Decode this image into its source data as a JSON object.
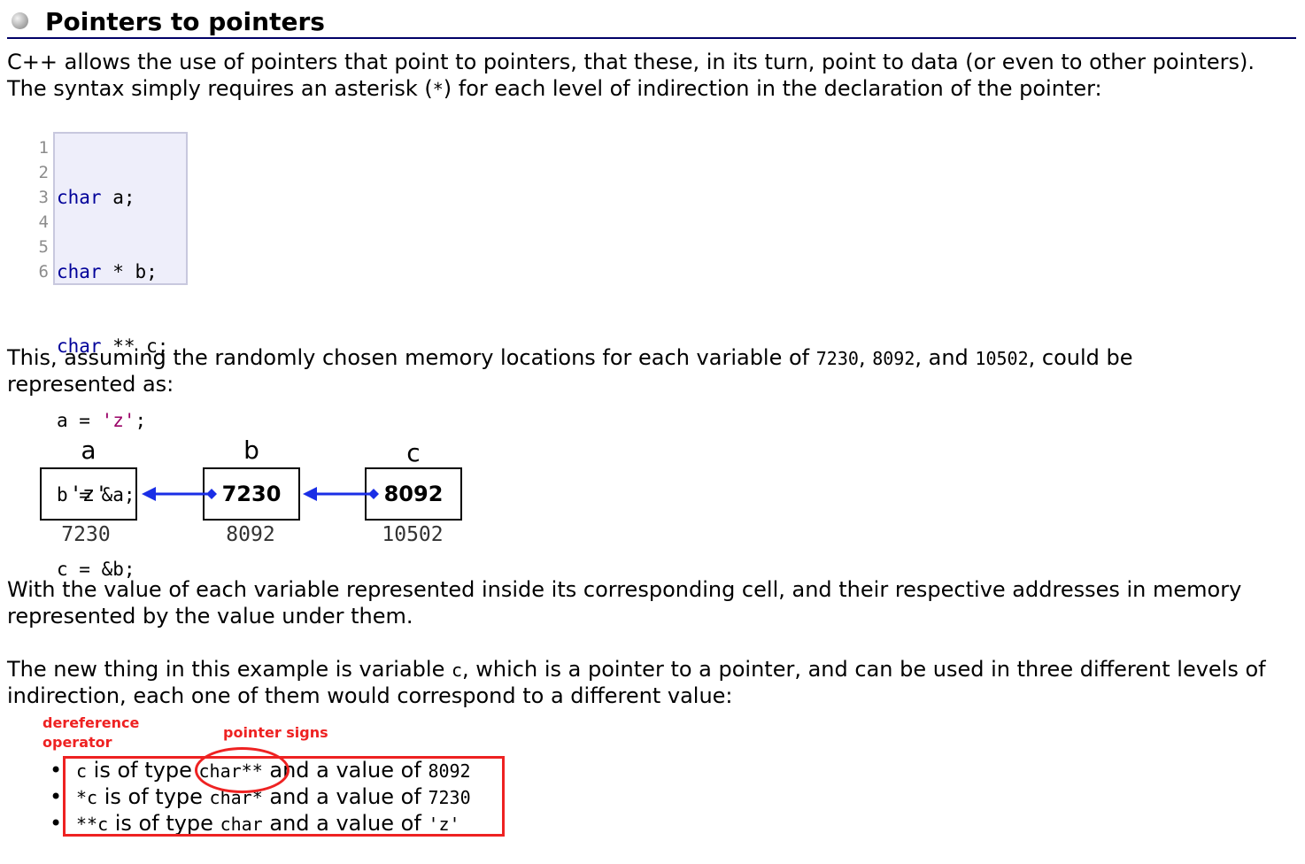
{
  "heading": {
    "icon": "bullet-icon",
    "title": "Pointers to pointers"
  },
  "intro": {
    "line1": "C++ allows the use of pointers that point to pointers, that these, in its turn, point to data (or even to other pointers).",
    "line2_pre": "The syntax simply requires an asterisk (",
    "line2_code": "*",
    "line2_post": ") for each level of indirection in the declaration of the pointer:"
  },
  "code": {
    "line_numbers": [
      "1",
      "2",
      "3",
      "4",
      "5",
      "6"
    ],
    "lines": [
      {
        "kw": "char",
        "rest": " a;"
      },
      {
        "kw": "char",
        "rest": " * b;"
      },
      {
        "kw": "char",
        "rest": " ** c;"
      },
      {
        "pre": "a = ",
        "str": "'z'",
        "post": ";"
      },
      {
        "pre": "b = &a;"
      },
      {
        "pre": "c = &b;"
      }
    ]
  },
  "assume": {
    "line1_pre": "This, assuming the randomly chosen memory locations for each variable of ",
    "v1": "7230",
    "sep1": ", ",
    "v2": "8092",
    "sep2": ", and ",
    "v3": "10502",
    "line1_post": ", could be",
    "line2": "represented as:"
  },
  "diagram": {
    "cells": [
      {
        "name": "a",
        "value": "'z'",
        "address": "7230"
      },
      {
        "name": "b",
        "value": "7230",
        "address": "8092"
      },
      {
        "name": "c",
        "value": "8092",
        "address": "10502"
      }
    ],
    "arrow_color": "#1a2ee6"
  },
  "explain": {
    "line1": "With the value of each variable represented inside its corresponding cell, and their respective addresses in memory",
    "line2": "represented by the value under them."
  },
  "newthing": {
    "line1_pre": "The new thing in this example is variable ",
    "line1_code": "c",
    "line1_post": ", which is a pointer to a pointer, and can be used in three different levels of",
    "line2": "indirection, each one of them would correspond to a different value:"
  },
  "annotations": {
    "dereference_line1": "dereference",
    "dereference_line2": "operator",
    "pointer_signs": "pointer signs",
    "color": "#ee2222"
  },
  "list": [
    {
      "expr": "c",
      "mid": " is of type ",
      "type": "char**",
      "post": " and a value of ",
      "value": "8092"
    },
    {
      "expr": "*c",
      "mid": " is of type ",
      "type": "char*",
      "post": " and a value of ",
      "value": "7230"
    },
    {
      "expr": "**c",
      "mid": " is of type ",
      "type": "char",
      "post": " and a value of ",
      "value": "'z'"
    }
  ]
}
